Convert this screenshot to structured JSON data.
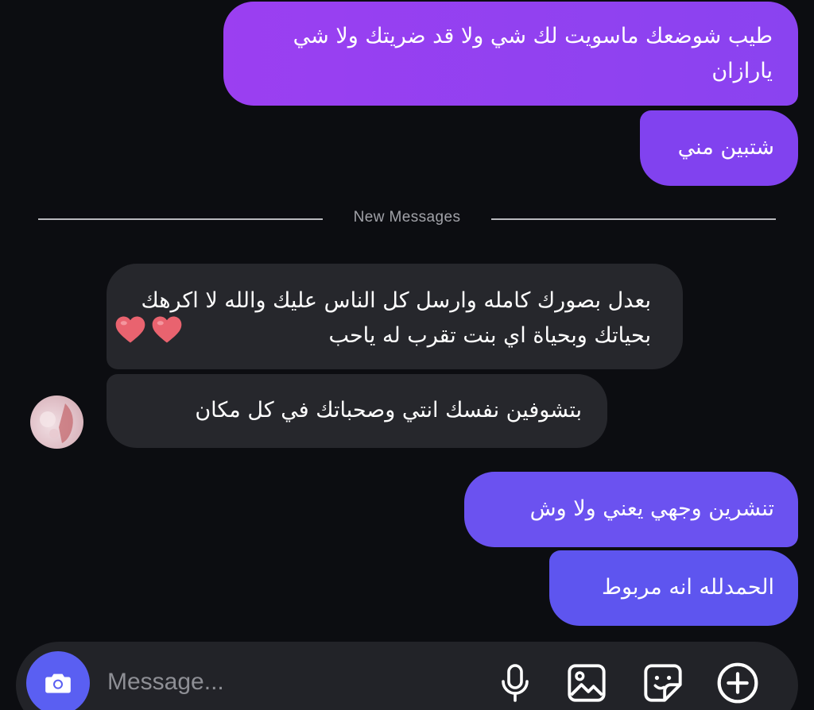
{
  "messages": {
    "sent_1": "طيب شوضعك ماسويت لك شي ولا قد ضريتك ولا شي يارازان",
    "sent_2": "شتبين مني",
    "recv_1": "بعدل بصورك كامله وارسل كل الناس عليك والله لا اكرهك بحياتك وبحياة اي بنت تقرب له ياحب",
    "recv_2": "بتشوفين نفسك انتي وصحباتك في كل مكان",
    "sent_3": "تنشرين وجهي يعني ولا وش",
    "sent_4": "الحمدلله انه مربوط"
  },
  "divider": {
    "label": "New Messages"
  },
  "composer": {
    "placeholder": "Message...",
    "camera_icon": "camera-icon",
    "mic_icon": "microphone-icon",
    "photo_icon": "image-icon",
    "sticker_icon": "sticker-icon",
    "plus_icon": "plus-circle-icon"
  },
  "colors": {
    "background": "#0c0d11",
    "sent_bubble_top": "#9b3ff1",
    "sent_bubble_bottom": "#5e55ef",
    "received_bubble": "#26272c",
    "camera_button": "#5a5ff2",
    "heart": "#e9636f"
  }
}
